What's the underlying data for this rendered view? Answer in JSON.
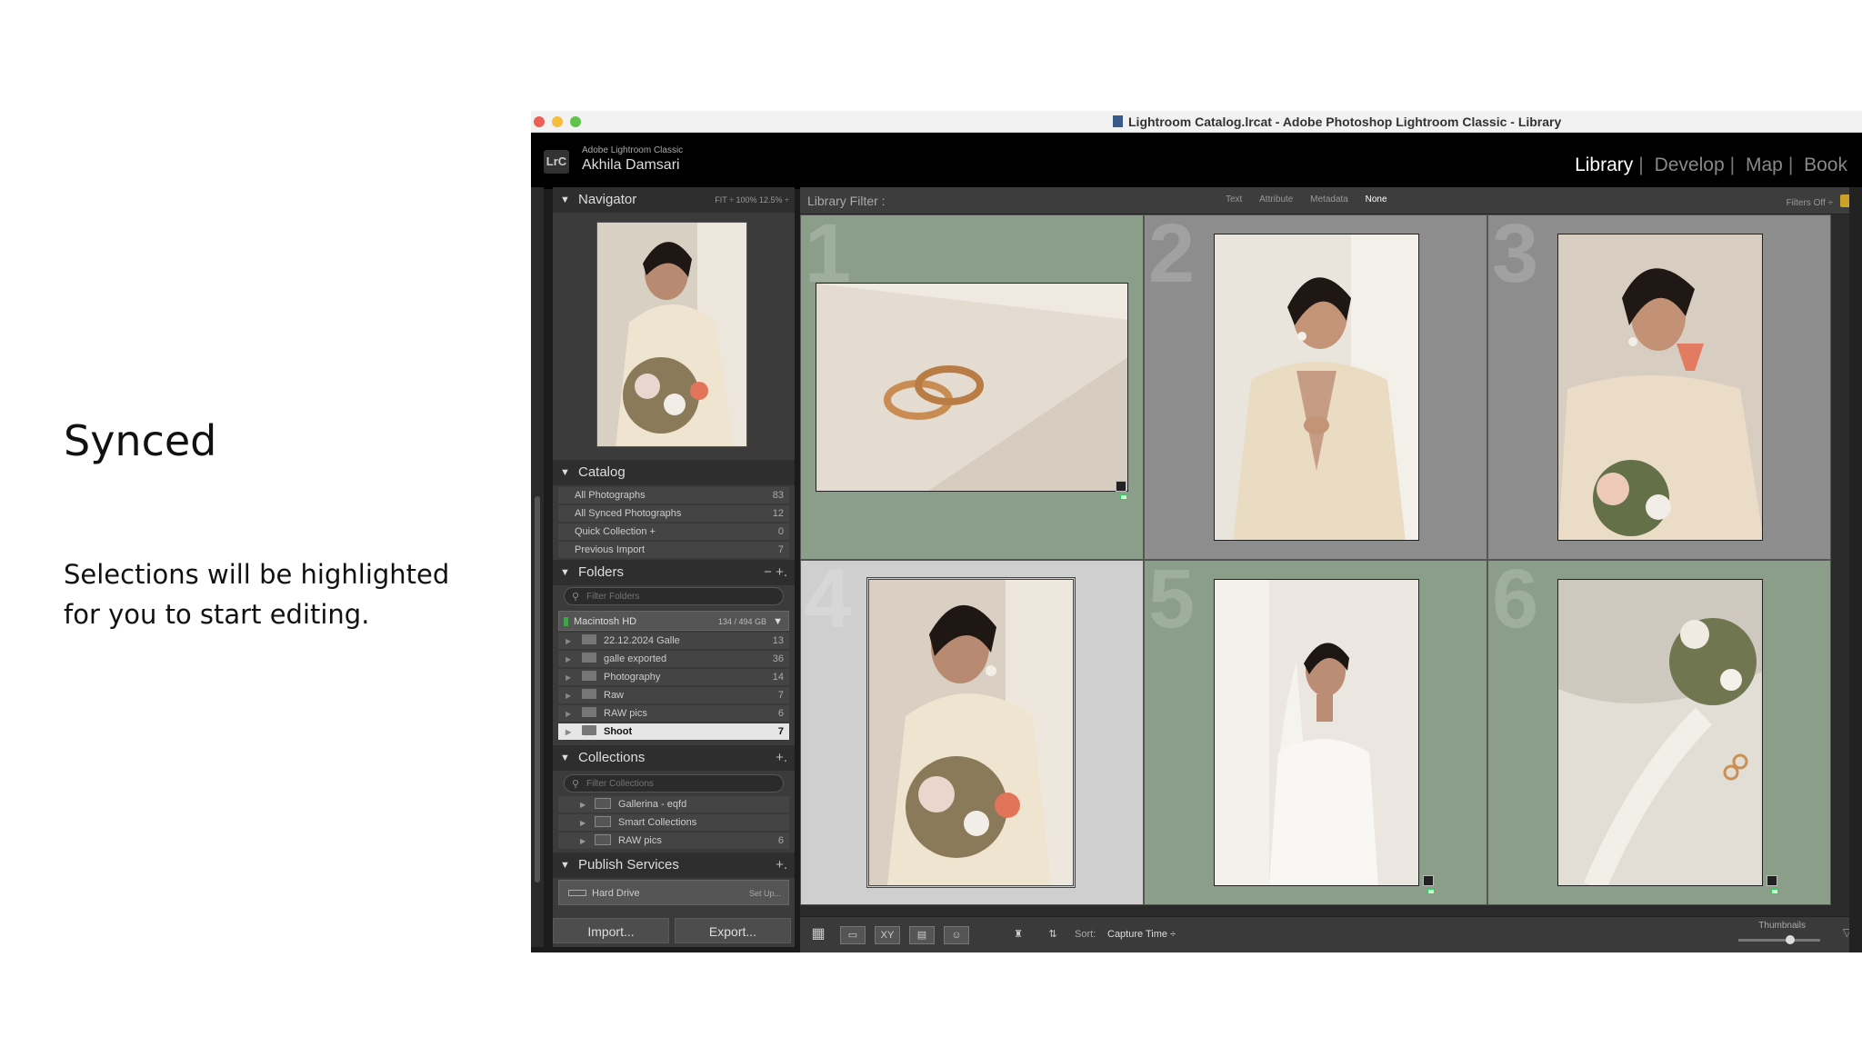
{
  "slide": {
    "title": "Synced",
    "body": "Selections will be highlighted for you to start editing."
  },
  "window": {
    "title": "Lightroom Catalog.lrcat - Adobe Photoshop Lightroom Classic - Library"
  },
  "identity": {
    "logo": "LrC",
    "product": "Adobe Lightroom Classic",
    "user": "Akhila Damsari",
    "modules": [
      "Library",
      "Develop",
      "Map",
      "Book"
    ],
    "active_module": "Library"
  },
  "navigator": {
    "title": "Navigator",
    "options": "FIT ÷   100%   12.5%  ÷"
  },
  "catalog": {
    "title": "Catalog",
    "items": [
      {
        "label": "All Photographs",
        "count": "83"
      },
      {
        "label": "All Synced Photographs",
        "count": "12"
      },
      {
        "label": "Quick Collection +",
        "count": "0"
      },
      {
        "label": "Previous Import",
        "count": "7"
      }
    ]
  },
  "folders": {
    "title": "Folders",
    "controls": "−  +.",
    "search_placeholder": "Filter Folders",
    "volume": {
      "name": "Macintosh HD",
      "capacity": "134 / 494 GB"
    },
    "items": [
      {
        "label": "22.12.2024 Galle",
        "count": "13"
      },
      {
        "label": "galle exported",
        "count": "36"
      },
      {
        "label": "Photography",
        "count": "14"
      },
      {
        "label": "Raw",
        "count": "7"
      },
      {
        "label": "RAW pics",
        "count": "6"
      },
      {
        "label": "Shoot",
        "count": "7"
      }
    ],
    "selected": "Shoot"
  },
  "collections": {
    "title": "Collections",
    "plus": "+.",
    "search_placeholder": "Filter Collections",
    "items": [
      {
        "label": "Gallerina - eqfd",
        "count": ""
      },
      {
        "label": "Smart Collections",
        "count": ""
      },
      {
        "label": "RAW pics",
        "count": "6"
      }
    ]
  },
  "publish": {
    "title": "Publish Services",
    "plus": "+.",
    "hard_drive": "Hard Drive",
    "setup": "Set Up..."
  },
  "buttons": {
    "import": "Import...",
    "export": "Export..."
  },
  "filter": {
    "label": "Library Filter :",
    "options": [
      "Text",
      "Attribute",
      "Metadata",
      "None"
    ],
    "active": "None",
    "status": "Filters Off ÷"
  },
  "grid": {
    "cells": [
      {
        "num": "1",
        "bg": "#8a9e89"
      },
      {
        "num": "2",
        "bg": "#8d8d8d"
      },
      {
        "num": "3",
        "bg": "#8d8d8d"
      },
      {
        "num": "4",
        "bg": "#cfcfcf"
      },
      {
        "num": "5",
        "bg": "#8a9e89"
      },
      {
        "num": "6",
        "bg": "#8a9e89"
      }
    ]
  },
  "toolbar": {
    "sort_label": "Sort:",
    "sort_value": "Capture Time ÷",
    "thumbnails_label": "Thumbnails"
  },
  "colors": {
    "synced_cell": "#8a9e89",
    "selected_cell": "#cfcfcf",
    "normal_cell": "#8d8d8d"
  }
}
